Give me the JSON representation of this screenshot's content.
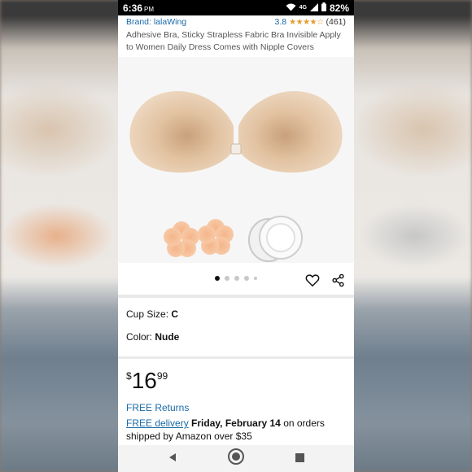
{
  "status_bar": {
    "time": "6:36",
    "ampm": "PM",
    "network": "4G",
    "battery": "82%"
  },
  "product": {
    "brand": "Brand: lalaWing",
    "rating": "3.8",
    "stars": "★★★★☆",
    "review_count": "(461)",
    "title": "Adhesive Bra, Sticky Strapless Fabric Bra Invisible Apply to Women Daily Dress Comes with Nipple Covers"
  },
  "gallery": {
    "image_count": 5,
    "active_index": 0
  },
  "options": {
    "cup_label": "Cup Size:",
    "cup_value": "C",
    "color_label": "Color:",
    "color_value": "Nude"
  },
  "price": {
    "currency": "$",
    "whole": "16",
    "cents": "99"
  },
  "shipping": {
    "returns": "FREE Returns",
    "delivery_link": "FREE delivery",
    "delivery_date": "Friday, February 14",
    "delivery_rest": " on orders shipped by Amazon over $35"
  },
  "colors": {
    "link": "#1a6aa8",
    "star": "#e59b2c",
    "product_beige": "#e6c9a8"
  }
}
